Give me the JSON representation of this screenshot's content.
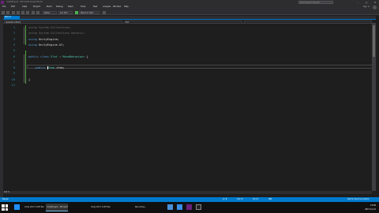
{
  "window": {
    "title": "UnityProject - Microsoft Visual Studio",
    "quick_launch_placeholder": "Quick Launch (Ctrl+Q)",
    "controls": [
      "–",
      "□",
      "✕"
    ]
  },
  "menu": {
    "items": [
      "File",
      "Edit",
      "View",
      "Project",
      "Build",
      "Debug",
      "Team",
      "Tools",
      "Test",
      "Analyze",
      "Window",
      "Help"
    ],
    "account": "Sign in"
  },
  "toolbar": {
    "config": "Debug",
    "platform": "Any CPU",
    "target": "Attach to Unity"
  },
  "tabs": [
    {
      "label": "Slot.cs"
    }
  ],
  "navigation": {
    "project": "Assembly-CSharp",
    "class": "Slot",
    "member": ""
  },
  "editor": {
    "zoom": "100 %",
    "lines": [
      {
        "num": "1",
        "tokens": [
          {
            "t": "using ",
            "c": "kw faded"
          },
          {
            "t": "System.Collections;",
            "c": "faded"
          }
        ]
      },
      {
        "num": "2",
        "tokens": [
          {
            "t": "using ",
            "c": "kw faded"
          },
          {
            "t": "System.Collections.Generic;",
            "c": "faded"
          }
        ]
      },
      {
        "num": "3",
        "tokens": [
          {
            "t": "using ",
            "c": "kw"
          },
          {
            "t": "UnityEngine;",
            "c": ""
          }
        ]
      },
      {
        "num": "4",
        "tokens": [
          {
            "t": "using ",
            "c": "kw"
          },
          {
            "t": "UnityEngine.UI;",
            "c": ""
          }
        ]
      },
      {
        "num": "5",
        "tokens": []
      },
      {
        "num": "6",
        "tokens": [
          {
            "t": "public ",
            "c": "kw"
          },
          {
            "t": "class ",
            "c": "kw"
          },
          {
            "t": "Slot",
            "c": "type"
          },
          {
            "t": " : ",
            "c": ""
          },
          {
            "t": "MonoBehaviour",
            "c": "type"
          },
          {
            "t": " {",
            "c": ""
          }
        ]
      },
      {
        "num": "7",
        "tokens": []
      },
      {
        "num": "8",
        "tokens": [
          {
            "t": "    public ",
            "c": "kw"
          },
          {
            "t": "Item",
            "c": "type"
          },
          {
            "t": " item;",
            "c": ""
          }
        ]
      },
      {
        "num": "9",
        "tokens": []
      },
      {
        "num": "10",
        "tokens": [
          {
            "t": "}",
            "c": ""
          }
        ]
      },
      {
        "num": "11",
        "tokens": []
      }
    ]
  },
  "status": {
    "left": "Ready",
    "ln": "Ln 8",
    "col": "Col 17",
    "ch": "Ch 17",
    "ins": "INS",
    "source_control": "Add to Source Control"
  },
  "taskbar": {
    "tasks": [
      {
        "label": "Unity 2017.3.0f3 Personal",
        "active": false
      },
      {
        "label": "UnityProject - Microsoft",
        "active": true
      },
      {
        "label": "Unity 2017.3.0f3 Person",
        "active": false
      },
      {
        "label": "Recording...",
        "active": false
      }
    ],
    "time": "13:56",
    "date": "2017-12-21"
  },
  "colors": {
    "accent": "#007acc",
    "keyword": "#569cd6",
    "type": "#4ec9b0",
    "line_number": "#2b91af"
  }
}
